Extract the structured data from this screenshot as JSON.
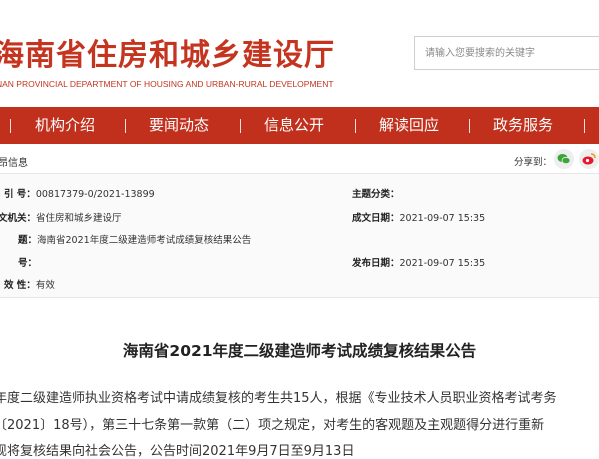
{
  "header": {
    "title": "海南省住房和城乡建设厅",
    "subtitle": "NAN PROVINCIAL DEPARTMENT OF HOUSING AND URBAN-RURAL DEVELOPMENT",
    "search_placeholder": "请输入您要搜索的关键字"
  },
  "nav": {
    "items": [
      "机构介绍",
      "要闻动态",
      "信息公开",
      "解读回应",
      "政务服务"
    ]
  },
  "breadcrumb": "昂信息",
  "share": {
    "label": "分享到：",
    "icons": [
      "wechat-icon",
      "weibo-icon"
    ]
  },
  "meta": {
    "index_label": "引 号：",
    "index_value": "00817379-0/2021-13899",
    "org_label": "文机关：",
    "org_value": "省住房和城乡建设厅",
    "title_label": "题：",
    "title_value": "海南省2021年度二级建造师考试成绩复核结果公告",
    "number_label": "号：",
    "number_value": "",
    "valid_label": "效 性：",
    "valid_value": "有效",
    "subject_label": "主题分类：",
    "subject_value": "",
    "written_label": "成文日期：",
    "written_value": "2021-09-07 15:35",
    "published_label": "发布日期：",
    "published_value": "2021-09-07 15:35"
  },
  "article": {
    "title": "海南省2021年度二级建造师考试成绩复核结果公告",
    "lines": [
      "年度二级建造师执业资格考试中请成绩复核的考生共15人，根据《专业技术人员职业资格考试考务",
      "〔2021〕18号），第三十七条第一款第（二）项之规定，对考生的客观题及主观题得分进行重新",
      "现将复核结果向社会公告，公告时间2021年9月7日至9月13日"
    ]
  },
  "colors": {
    "brand": "#c0301c",
    "text": "#333333"
  }
}
